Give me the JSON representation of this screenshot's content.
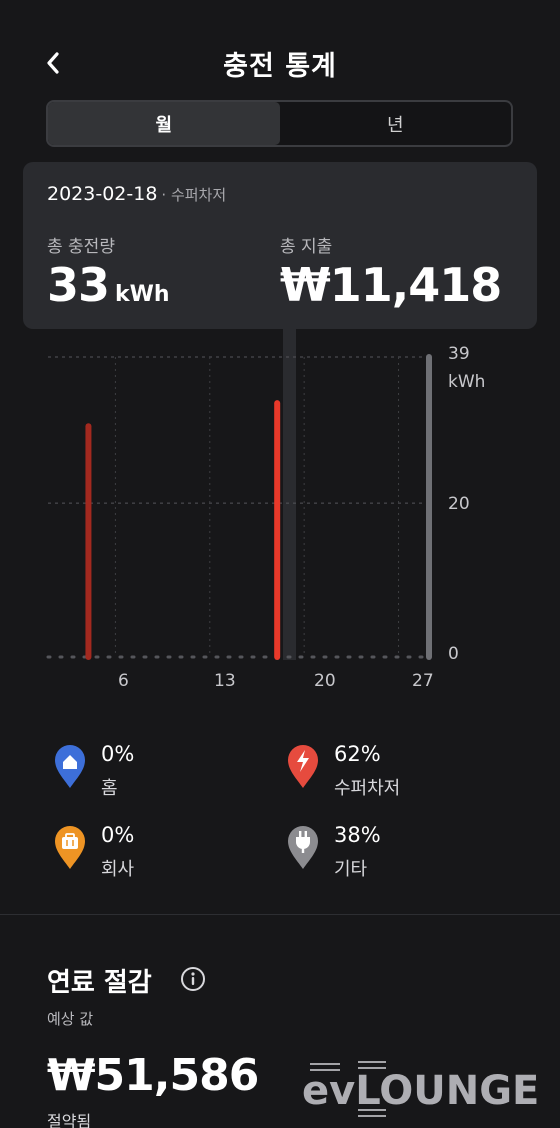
{
  "header": {
    "title": "충전 통계",
    "back_icon": "chevron-left-icon"
  },
  "period_tabs": [
    {
      "label": "월",
      "active": true
    },
    {
      "label": "년",
      "active": false
    }
  ],
  "tooltip": {
    "date": "2023-02-18",
    "location": "· 수퍼차저",
    "energy_label": "총 충전량",
    "energy_value": "33",
    "energy_unit": "kWh",
    "cost_label": "총 지출",
    "cost_value": "₩11,418"
  },
  "chart_data": {
    "type": "bar",
    "x_ticks": [
      "6",
      "13",
      "20",
      "27"
    ],
    "y_ticks": [
      "0",
      "20",
      "39"
    ],
    "y_unit": "kWh",
    "ylim": [
      0,
      39
    ],
    "xlim": [
      1,
      28
    ],
    "bars": [
      {
        "day": 4,
        "value": 30,
        "color": "#a3291f"
      },
      {
        "day": 18,
        "value": 33,
        "color": "#e8392a",
        "selected": true
      }
    ],
    "grid": true
  },
  "legend": [
    {
      "pct": "0%",
      "name": "홈",
      "icon": "home-pin-icon",
      "color": "#3d6fd9"
    },
    {
      "pct": "62%",
      "name": "수퍼차저",
      "icon": "supercharger-pin-icon",
      "color": "#e64b3e"
    },
    {
      "pct": "0%",
      "name": "회사",
      "icon": "work-pin-icon",
      "color": "#ee9424"
    },
    {
      "pct": "38%",
      "name": "기타",
      "icon": "plug-pin-icon",
      "color": "#8c8c90"
    }
  ],
  "savings": {
    "title": "연료 절감",
    "subtitle": "예상 값",
    "value": "₩51,586",
    "note": "절약됨"
  },
  "watermark": {
    "text": "evLOUNGE"
  },
  "colors": {
    "background": "#171719",
    "card": "#2a2b2f",
    "accent": "#e8392a"
  }
}
